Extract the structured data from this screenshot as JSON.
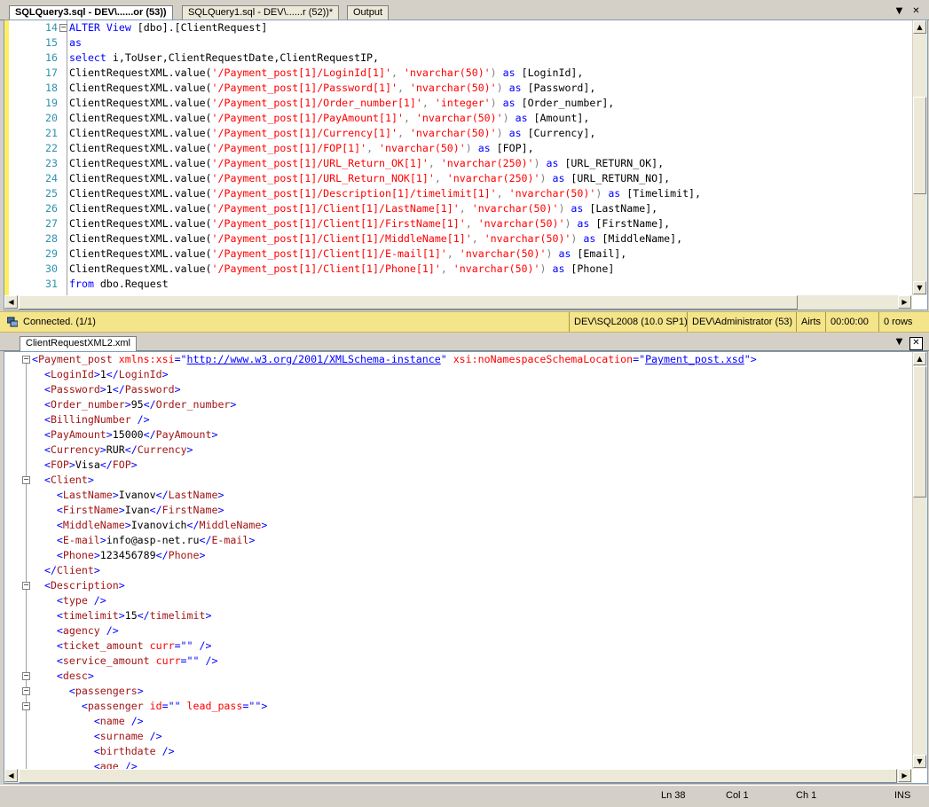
{
  "top_tabs": [
    "SQLQuery3.sql - DEV\\......or (53))",
    "SQLQuery1.sql - DEV\\......r (52))*",
    "Output"
  ],
  "win_buttons": {
    "dropdown": "▼",
    "close": "✕"
  },
  "sql_lines": [
    {
      "n": "14",
      "parts": [
        [
          "k",
          "ALTER"
        ],
        [
          "t",
          " "
        ],
        [
          "k",
          "View"
        ],
        [
          "t",
          " [dbo].[ClientRequest]"
        ]
      ]
    },
    {
      "n": "15",
      "parts": [
        [
          "k",
          "as"
        ]
      ]
    },
    {
      "n": "16",
      "parts": [
        [
          "k",
          "select"
        ],
        [
          "t",
          " i,ToUser,ClientRequestDate,ClientRequestIP,"
        ]
      ]
    },
    {
      "n": "17",
      "parts": [
        [
          "t",
          "ClientRequestXML.value("
        ],
        [
          "s",
          "'/Payment_post[1]/LoginId[1]'"
        ],
        [
          "g",
          ", "
        ],
        [
          "s",
          "'nvarchar(50)'"
        ],
        [
          "g",
          ") "
        ],
        [
          "k",
          "as"
        ],
        [
          "t",
          " [LoginId],"
        ]
      ]
    },
    {
      "n": "18",
      "parts": [
        [
          "t",
          "ClientRequestXML.value("
        ],
        [
          "s",
          "'/Payment_post[1]/Password[1]'"
        ],
        [
          "g",
          ", "
        ],
        [
          "s",
          "'nvarchar(50)'"
        ],
        [
          "g",
          ") "
        ],
        [
          "k",
          "as"
        ],
        [
          "t",
          " [Password],"
        ]
      ]
    },
    {
      "n": "19",
      "parts": [
        [
          "t",
          "ClientRequestXML.value("
        ],
        [
          "s",
          "'/Payment_post[1]/Order_number[1]'"
        ],
        [
          "g",
          ", "
        ],
        [
          "s",
          "'integer'"
        ],
        [
          "g",
          ") "
        ],
        [
          "k",
          "as"
        ],
        [
          "t",
          " [Order_number],"
        ]
      ]
    },
    {
      "n": "20",
      "parts": [
        [
          "t",
          "ClientRequestXML.value("
        ],
        [
          "s",
          "'/Payment_post[1]/PayAmount[1]'"
        ],
        [
          "g",
          ", "
        ],
        [
          "s",
          "'nvarchar(50)'"
        ],
        [
          "g",
          ") "
        ],
        [
          "k",
          "as"
        ],
        [
          "t",
          " [Amount],"
        ]
      ]
    },
    {
      "n": "21",
      "parts": [
        [
          "t",
          "ClientRequestXML.value("
        ],
        [
          "s",
          "'/Payment_post[1]/Currency[1]'"
        ],
        [
          "g",
          ", "
        ],
        [
          "s",
          "'nvarchar(50)'"
        ],
        [
          "g",
          ") "
        ],
        [
          "k",
          "as"
        ],
        [
          "t",
          " [Currency],"
        ]
      ]
    },
    {
      "n": "22",
      "parts": [
        [
          "t",
          "ClientRequestXML.value("
        ],
        [
          "s",
          "'/Payment_post[1]/FOP[1]'"
        ],
        [
          "g",
          ", "
        ],
        [
          "s",
          "'nvarchar(50)'"
        ],
        [
          "g",
          ") "
        ],
        [
          "k",
          "as"
        ],
        [
          "t",
          " [FOP],"
        ]
      ]
    },
    {
      "n": "23",
      "parts": [
        [
          "t",
          "ClientRequestXML.value("
        ],
        [
          "s",
          "'/Payment_post[1]/URL_Return_OK[1]'"
        ],
        [
          "g",
          ", "
        ],
        [
          "s",
          "'nvarchar(250)'"
        ],
        [
          "g",
          ") "
        ],
        [
          "k",
          "as"
        ],
        [
          "t",
          " [URL_RETURN_OK],"
        ]
      ]
    },
    {
      "n": "24",
      "parts": [
        [
          "t",
          "ClientRequestXML.value("
        ],
        [
          "s",
          "'/Payment_post[1]/URL_Return_NOK[1]'"
        ],
        [
          "g",
          ", "
        ],
        [
          "s",
          "'nvarchar(250)'"
        ],
        [
          "g",
          ") "
        ],
        [
          "k",
          "as"
        ],
        [
          "t",
          " [URL_RETURN_NO],"
        ]
      ]
    },
    {
      "n": "25",
      "parts": [
        [
          "t",
          "ClientRequestXML.value("
        ],
        [
          "s",
          "'/Payment_post[1]/Description[1]/timelimit[1]'"
        ],
        [
          "g",
          ", "
        ],
        [
          "s",
          "'nvarchar(50)'"
        ],
        [
          "g",
          ") "
        ],
        [
          "k",
          "as"
        ],
        [
          "t",
          " [Timelimit],"
        ]
      ]
    },
    {
      "n": "26",
      "parts": [
        [
          "t",
          "ClientRequestXML.value("
        ],
        [
          "s",
          "'/Payment_post[1]/Client[1]/LastName[1]'"
        ],
        [
          "g",
          ", "
        ],
        [
          "s",
          "'nvarchar(50)'"
        ],
        [
          "g",
          ") "
        ],
        [
          "k",
          "as"
        ],
        [
          "t",
          " [LastName],"
        ]
      ]
    },
    {
      "n": "27",
      "parts": [
        [
          "t",
          "ClientRequestXML.value("
        ],
        [
          "s",
          "'/Payment_post[1]/Client[1]/FirstName[1]'"
        ],
        [
          "g",
          ", "
        ],
        [
          "s",
          "'nvarchar(50)'"
        ],
        [
          "g",
          ") "
        ],
        [
          "k",
          "as"
        ],
        [
          "t",
          " [FirstName],"
        ]
      ]
    },
    {
      "n": "28",
      "parts": [
        [
          "t",
          "ClientRequestXML.value("
        ],
        [
          "s",
          "'/Payment_post[1]/Client[1]/MiddleName[1]'"
        ],
        [
          "g",
          ", "
        ],
        [
          "s",
          "'nvarchar(50)'"
        ],
        [
          "g",
          ") "
        ],
        [
          "k",
          "as"
        ],
        [
          "t",
          " [MiddleName],"
        ]
      ]
    },
    {
      "n": "29",
      "parts": [
        [
          "t",
          "ClientRequestXML.value("
        ],
        [
          "s",
          "'/Payment_post[1]/Client[1]/E-mail[1]'"
        ],
        [
          "g",
          ", "
        ],
        [
          "s",
          "'nvarchar(50)'"
        ],
        [
          "g",
          ") "
        ],
        [
          "k",
          "as"
        ],
        [
          "t",
          " [Email],"
        ]
      ]
    },
    {
      "n": "30",
      "parts": [
        [
          "t",
          "ClientRequestXML.value("
        ],
        [
          "s",
          "'/Payment_post[1]/Client[1]/Phone[1]'"
        ],
        [
          "g",
          ", "
        ],
        [
          "s",
          "'nvarchar(50)'"
        ],
        [
          "g",
          ") "
        ],
        [
          "k",
          "as"
        ],
        [
          "t",
          " [Phone]"
        ]
      ]
    },
    {
      "n": "31",
      "parts": [
        [
          "k",
          "from"
        ],
        [
          "t",
          " dbo.Request"
        ]
      ]
    }
  ],
  "status": {
    "connection": "Connected. (1/1)",
    "server": "DEV\\SQL2008 (10.0 SP1)",
    "user": "DEV\\Administrator (53)",
    "database": "Airts",
    "time": "00:00:00",
    "rows": "0 rows"
  },
  "xml_tab": "ClientRequestXML2.xml",
  "xml_lines": [
    {
      "fold": "-",
      "parts": [
        [
          "xb",
          "<"
        ],
        [
          "xt",
          "Payment_post"
        ],
        [
          "xs",
          " "
        ],
        [
          "xa",
          "xmlns:xsi"
        ],
        [
          "xb",
          "=\""
        ],
        [
          "link",
          "http://www.w3.org/2001/XMLSchema-instance"
        ],
        [
          "xb",
          "\""
        ],
        [
          "xs",
          " "
        ],
        [
          "xa",
          "xsi:noNamespaceSchemaLocation"
        ],
        [
          "xb",
          "=\""
        ],
        [
          "link",
          "Payment_post.xsd"
        ],
        [
          "xb",
          "\">"
        ]
      ]
    },
    {
      "parts": [
        [
          "xs",
          "  "
        ],
        [
          "xb",
          "<"
        ],
        [
          "xt",
          "LoginId"
        ],
        [
          "xb",
          ">"
        ],
        [
          "xs",
          "1"
        ],
        [
          "xb",
          "</"
        ],
        [
          "xt",
          "LoginId"
        ],
        [
          "xb",
          ">"
        ]
      ]
    },
    {
      "parts": [
        [
          "xs",
          "  "
        ],
        [
          "xb",
          "<"
        ],
        [
          "xt",
          "Password"
        ],
        [
          "xb",
          ">"
        ],
        [
          "xs",
          "1"
        ],
        [
          "xb",
          "</"
        ],
        [
          "xt",
          "Password"
        ],
        [
          "xb",
          ">"
        ]
      ]
    },
    {
      "parts": [
        [
          "xs",
          "  "
        ],
        [
          "xb",
          "<"
        ],
        [
          "xt",
          "Order_number"
        ],
        [
          "xb",
          ">"
        ],
        [
          "xs",
          "95"
        ],
        [
          "xb",
          "</"
        ],
        [
          "xt",
          "Order_number"
        ],
        [
          "xb",
          ">"
        ]
      ]
    },
    {
      "parts": [
        [
          "xs",
          "  "
        ],
        [
          "xb",
          "<"
        ],
        [
          "xt",
          "BillingNumber"
        ],
        [
          "xb",
          " />"
        ]
      ]
    },
    {
      "parts": [
        [
          "xs",
          "  "
        ],
        [
          "xb",
          "<"
        ],
        [
          "xt",
          "PayAmount"
        ],
        [
          "xb",
          ">"
        ],
        [
          "xs",
          "15000"
        ],
        [
          "xb",
          "</"
        ],
        [
          "xt",
          "PayAmount"
        ],
        [
          "xb",
          ">"
        ]
      ]
    },
    {
      "parts": [
        [
          "xs",
          "  "
        ],
        [
          "xb",
          "<"
        ],
        [
          "xt",
          "Currency"
        ],
        [
          "xb",
          ">"
        ],
        [
          "xs",
          "RUR"
        ],
        [
          "xb",
          "</"
        ],
        [
          "xt",
          "Currency"
        ],
        [
          "xb",
          ">"
        ]
      ]
    },
    {
      "parts": [
        [
          "xs",
          "  "
        ],
        [
          "xb",
          "<"
        ],
        [
          "xt",
          "FOP"
        ],
        [
          "xb",
          ">"
        ],
        [
          "xs",
          "Visa"
        ],
        [
          "xb",
          "</"
        ],
        [
          "xt",
          "FOP"
        ],
        [
          "xb",
          ">"
        ]
      ]
    },
    {
      "fold": "-",
      "parts": [
        [
          "xs",
          "  "
        ],
        [
          "xb",
          "<"
        ],
        [
          "xt",
          "Client"
        ],
        [
          "xb",
          ">"
        ]
      ]
    },
    {
      "parts": [
        [
          "xs",
          "    "
        ],
        [
          "xb",
          "<"
        ],
        [
          "xt",
          "LastName"
        ],
        [
          "xb",
          ">"
        ],
        [
          "xs",
          "Ivanov"
        ],
        [
          "xb",
          "</"
        ],
        [
          "xt",
          "LastName"
        ],
        [
          "xb",
          ">"
        ]
      ]
    },
    {
      "parts": [
        [
          "xs",
          "    "
        ],
        [
          "xb",
          "<"
        ],
        [
          "xt",
          "FirstName"
        ],
        [
          "xb",
          ">"
        ],
        [
          "xs",
          "Ivan"
        ],
        [
          "xb",
          "</"
        ],
        [
          "xt",
          "FirstName"
        ],
        [
          "xb",
          ">"
        ]
      ]
    },
    {
      "parts": [
        [
          "xs",
          "    "
        ],
        [
          "xb",
          "<"
        ],
        [
          "xt",
          "MiddleName"
        ],
        [
          "xb",
          ">"
        ],
        [
          "xs",
          "Ivanovich"
        ],
        [
          "xb",
          "</"
        ],
        [
          "xt",
          "MiddleName"
        ],
        [
          "xb",
          ">"
        ]
      ]
    },
    {
      "parts": [
        [
          "xs",
          "    "
        ],
        [
          "xb",
          "<"
        ],
        [
          "xt",
          "E-mail"
        ],
        [
          "xb",
          ">"
        ],
        [
          "xs",
          "info@asp-net.ru"
        ],
        [
          "xb",
          "</"
        ],
        [
          "xt",
          "E-mail"
        ],
        [
          "xb",
          ">"
        ]
      ]
    },
    {
      "parts": [
        [
          "xs",
          "    "
        ],
        [
          "xb",
          "<"
        ],
        [
          "xt",
          "Phone"
        ],
        [
          "xb",
          ">"
        ],
        [
          "xs",
          "123456789"
        ],
        [
          "xb",
          "</"
        ],
        [
          "xt",
          "Phone"
        ],
        [
          "xb",
          ">"
        ]
      ]
    },
    {
      "parts": [
        [
          "xs",
          "  "
        ],
        [
          "xb",
          "</"
        ],
        [
          "xt",
          "Client"
        ],
        [
          "xb",
          ">"
        ]
      ]
    },
    {
      "fold": "-",
      "parts": [
        [
          "xs",
          "  "
        ],
        [
          "xb",
          "<"
        ],
        [
          "xt",
          "Description"
        ],
        [
          "xb",
          ">"
        ]
      ]
    },
    {
      "parts": [
        [
          "xs",
          "    "
        ],
        [
          "xb",
          "<"
        ],
        [
          "xt",
          "type"
        ],
        [
          "xb",
          " />"
        ]
      ]
    },
    {
      "parts": [
        [
          "xs",
          "    "
        ],
        [
          "xb",
          "<"
        ],
        [
          "xt",
          "timelimit"
        ],
        [
          "xb",
          ">"
        ],
        [
          "xs",
          "15"
        ],
        [
          "xb",
          "</"
        ],
        [
          "xt",
          "timelimit"
        ],
        [
          "xb",
          ">"
        ]
      ]
    },
    {
      "parts": [
        [
          "xs",
          "    "
        ],
        [
          "xb",
          "<"
        ],
        [
          "xt",
          "agency"
        ],
        [
          "xb",
          " />"
        ]
      ]
    },
    {
      "parts": [
        [
          "xs",
          "    "
        ],
        [
          "xb",
          "<"
        ],
        [
          "xt",
          "ticket_amount"
        ],
        [
          "xs",
          " "
        ],
        [
          "xa",
          "curr"
        ],
        [
          "xb",
          "=\"\""
        ],
        [
          "xb",
          " />"
        ]
      ]
    },
    {
      "parts": [
        [
          "xs",
          "    "
        ],
        [
          "xb",
          "<"
        ],
        [
          "xt",
          "service_amount"
        ],
        [
          "xs",
          " "
        ],
        [
          "xa",
          "curr"
        ],
        [
          "xb",
          "=\"\""
        ],
        [
          "xb",
          " />"
        ]
      ]
    },
    {
      "fold": "-",
      "parts": [
        [
          "xs",
          "    "
        ],
        [
          "xb",
          "<"
        ],
        [
          "xt",
          "desc"
        ],
        [
          "xb",
          ">"
        ]
      ]
    },
    {
      "fold": "-",
      "parts": [
        [
          "xs",
          "      "
        ],
        [
          "xb",
          "<"
        ],
        [
          "xt",
          "passengers"
        ],
        [
          "xb",
          ">"
        ]
      ]
    },
    {
      "fold": "-",
      "parts": [
        [
          "xs",
          "        "
        ],
        [
          "xb",
          "<"
        ],
        [
          "xt",
          "passenger"
        ],
        [
          "xs",
          " "
        ],
        [
          "xa",
          "id"
        ],
        [
          "xb",
          "=\"\""
        ],
        [
          "xs",
          " "
        ],
        [
          "xa",
          "lead_pass"
        ],
        [
          "xb",
          "=\"\">"
        ]
      ]
    },
    {
      "parts": [
        [
          "xs",
          "          "
        ],
        [
          "xb",
          "<"
        ],
        [
          "xt",
          "name"
        ],
        [
          "xb",
          " />"
        ]
      ]
    },
    {
      "parts": [
        [
          "xs",
          "          "
        ],
        [
          "xb",
          "<"
        ],
        [
          "xt",
          "surname"
        ],
        [
          "xb",
          " />"
        ]
      ]
    },
    {
      "parts": [
        [
          "xs",
          "          "
        ],
        [
          "xb",
          "<"
        ],
        [
          "xt",
          "birthdate"
        ],
        [
          "xb",
          " />"
        ]
      ]
    },
    {
      "parts": [
        [
          "xs",
          "          "
        ],
        [
          "xb",
          "<"
        ],
        [
          "xt",
          "age"
        ],
        [
          "xb",
          " />"
        ]
      ]
    }
  ],
  "bottom_status": {
    "ln": "Ln 38",
    "col": "Col 1",
    "ch": "Ch 1",
    "mode": "INS"
  }
}
